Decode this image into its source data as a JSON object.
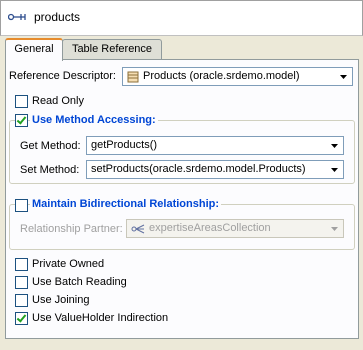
{
  "header": {
    "title": "products",
    "icon": "relationship-icon"
  },
  "tabs": [
    {
      "label": "General"
    },
    {
      "label": "Table Reference"
    }
  ],
  "general": {
    "reference_descriptor_label": "Reference Descriptor:",
    "reference_descriptor_value": "Products (oracle.srdemo.model)",
    "read_only_label": "Read Only",
    "use_method_accessing_label": "Use Method Accessing:",
    "get_method_label": "Get Method:",
    "get_method_value": "getProducts()",
    "set_method_label": "Set Method:",
    "set_method_value": "setProducts(oracle.srdemo.model.Products)",
    "maintain_bidirectional_label": "Maintain Bidirectional Relationship:",
    "relationship_partner_label": "Relationship Partner:",
    "relationship_partner_value": "expertiseAreasCollection",
    "private_owned_label": "Private Owned",
    "use_batch_reading_label": "Use Batch Reading",
    "use_joining_label": "Use Joining",
    "use_valueholder_label": "Use ValueHolder Indirection"
  },
  "checks": {
    "read_only": false,
    "use_method_accessing": true,
    "maintain_bidirectional": false,
    "private_owned": false,
    "use_batch_reading": false,
    "use_joining": false,
    "use_valueholder": true
  },
  "colors": {
    "group_title": "#0046d5",
    "check_mark": "#21a121",
    "tab_highlight": "#e68b2c"
  }
}
